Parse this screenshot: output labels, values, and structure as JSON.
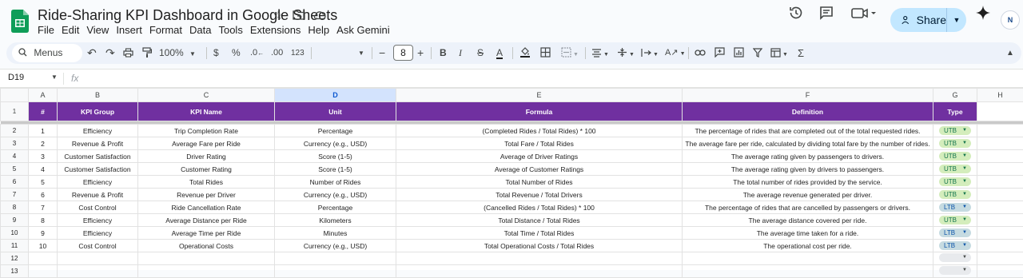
{
  "app": {
    "title": "Ride-Sharing KPI Dashboard in Google Sheets",
    "menu": [
      "File",
      "Edit",
      "View",
      "Insert",
      "Format",
      "Data",
      "Tools",
      "Extensions",
      "Help",
      "Ask Gemini"
    ],
    "share_label": "Share",
    "avatar_text": "N"
  },
  "toolbar": {
    "menus_label": "Menus",
    "zoom": "100%",
    "currency": "$",
    "percent": "%",
    "dec_decrease": ".0",
    "dec_increase": ".00",
    "number_format": "123",
    "font_size": "8"
  },
  "formula_bar": {
    "name_box": "D19",
    "fx": "fx",
    "value": ""
  },
  "columns": [
    "A",
    "B",
    "C",
    "D",
    "E",
    "F",
    "G",
    "H"
  ],
  "selected_column": "D",
  "header": [
    "#",
    "KPI Group",
    "KPI Name",
    "Unit",
    "Formula",
    "Definition",
    "Type"
  ],
  "rows": [
    {
      "row": "2",
      "n": "1",
      "group": "Efficiency",
      "name": "Trip Completion Rate",
      "unit": "Percentage",
      "formula": "(Completed Rides / Total Rides) * 100",
      "definition": "The percentage of rides that are completed out of the total requested rides.",
      "type": "UTB"
    },
    {
      "row": "3",
      "n": "2",
      "group": "Revenue & Profit",
      "name": "Average Fare per Ride",
      "unit": "Currency (e.g., USD)",
      "formula": "Total Fare / Total Rides",
      "definition": "The average fare per ride, calculated by dividing total fare by the number of rides.",
      "type": "UTB"
    },
    {
      "row": "4",
      "n": "3",
      "group": "Customer Satisfaction",
      "name": "Driver Rating",
      "unit": "Score (1-5)",
      "formula": "Average of Driver Ratings",
      "definition": "The average rating given by passengers to drivers.",
      "type": "UTB"
    },
    {
      "row": "5",
      "n": "4",
      "group": "Customer Satisfaction",
      "name": "Customer Rating",
      "unit": "Score (1-5)",
      "formula": "Average of Customer Ratings",
      "definition": "The average rating given by drivers to passengers.",
      "type": "UTB"
    },
    {
      "row": "6",
      "n": "5",
      "group": "Efficiency",
      "name": "Total Rides",
      "unit": "Number of Rides",
      "formula": "Total Number of Rides",
      "definition": "The total number of rides provided by the service.",
      "type": "UTB"
    },
    {
      "row": "7",
      "n": "6",
      "group": "Revenue & Profit",
      "name": "Revenue per Driver",
      "unit": "Currency (e.g., USD)",
      "formula": "Total Revenue / Total Drivers",
      "definition": "The average revenue generated per driver.",
      "type": "UTB"
    },
    {
      "row": "8",
      "n": "7",
      "group": "Cost Control",
      "name": "Ride Cancellation Rate",
      "unit": "Percentage",
      "formula": "(Cancelled Rides / Total Rides) * 100",
      "definition": "The percentage of rides that are cancelled by passengers or drivers.",
      "type": "LTB"
    },
    {
      "row": "9",
      "n": "8",
      "group": "Efficiency",
      "name": "Average Distance per Ride",
      "unit": "Kilometers",
      "formula": "Total Distance / Total Rides",
      "definition": "The average distance covered per ride.",
      "type": "UTB"
    },
    {
      "row": "10",
      "n": "9",
      "group": "Efficiency",
      "name": "Average Time per Ride",
      "unit": "Minutes",
      "formula": "Total Time / Total Rides",
      "definition": "The average time taken for a ride.",
      "type": "LTB"
    },
    {
      "row": "11",
      "n": "10",
      "group": "Cost Control",
      "name": "Operational Costs",
      "unit": "Currency (e.g., USD)",
      "formula": "Total Operational Costs / Total Rides",
      "definition": "The operational cost per ride.",
      "type": "LTB"
    }
  ],
  "empty_rows": [
    "12",
    "13"
  ],
  "colors": {
    "header_bg": "#7030a0",
    "utb_chip": "#d4edbc",
    "ltb_chip": "#c6dbe1"
  }
}
